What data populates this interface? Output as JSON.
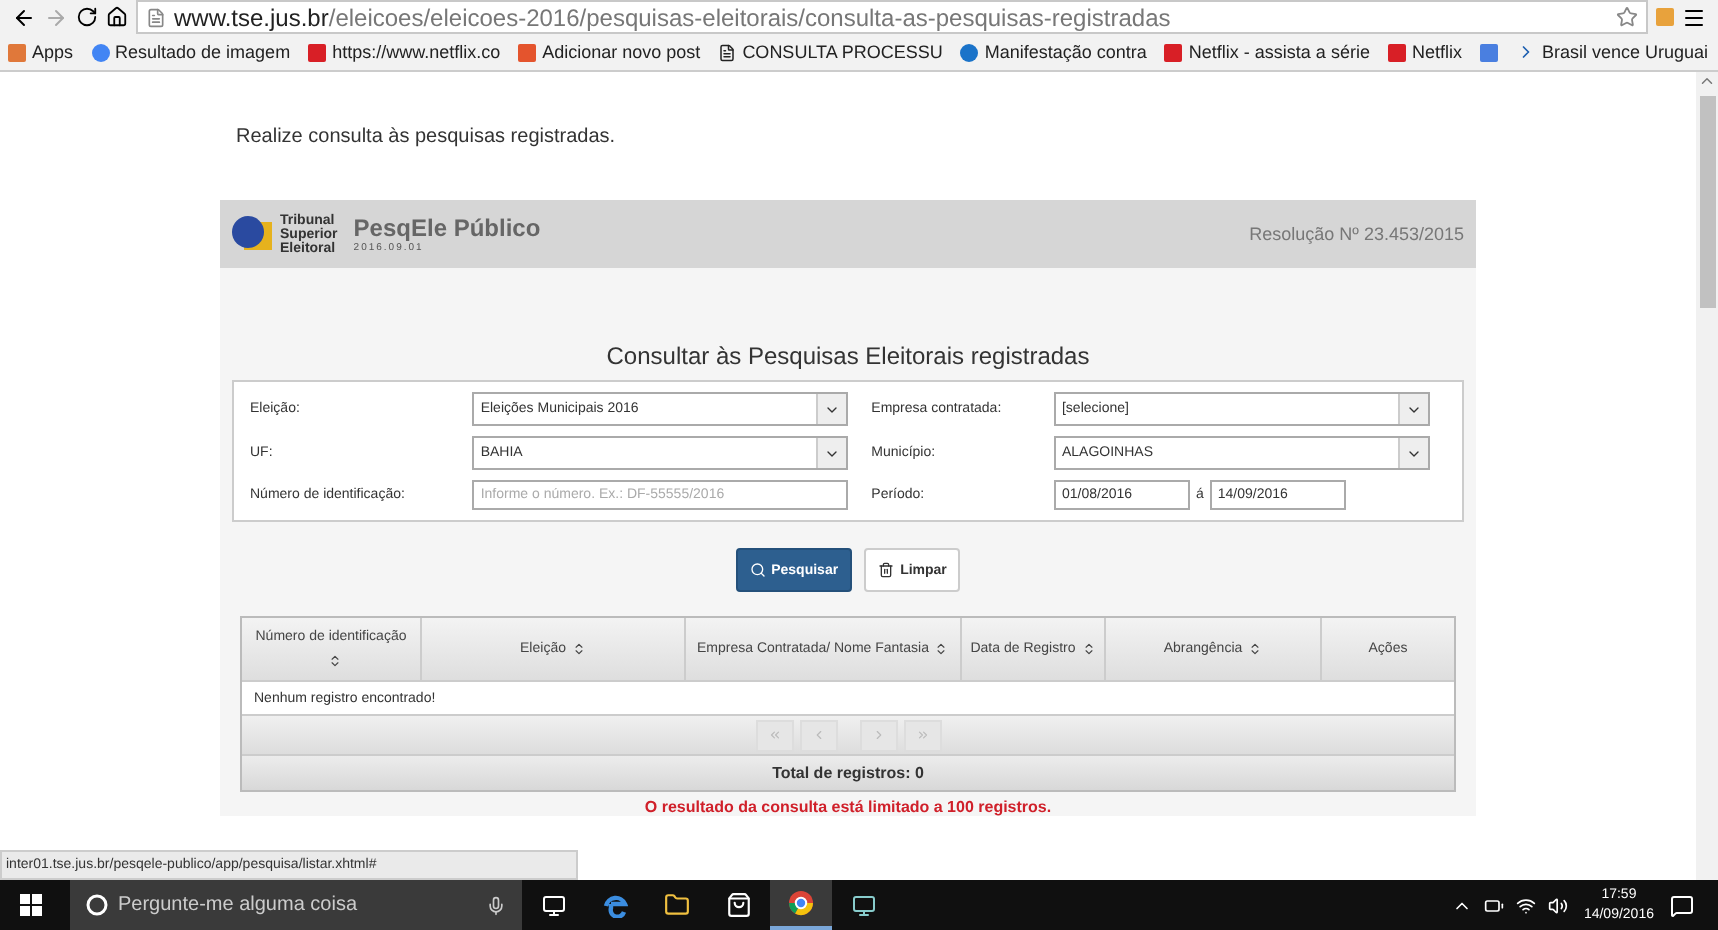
{
  "browser": {
    "url_host": "www.tse.jus.br",
    "url_path": "/eleicoes/eleicoes-2016/pesquisas-eleitorais/consulta-as-pesquisas-registradas",
    "bookmarks": [
      {
        "label": "Apps",
        "kind": "apps"
      },
      {
        "label": "Resultado de imagem",
        "kind": "google"
      },
      {
        "label": "https://www.netflix.co",
        "kind": "netflix"
      },
      {
        "label": "Adicionar novo post",
        "kind": "blog"
      },
      {
        "label": "CONSULTA PROCESSU",
        "kind": "page"
      },
      {
        "label": "Manifestação contra",
        "kind": "globe"
      },
      {
        "label": "Netflix - assista a série",
        "kind": "netflix"
      },
      {
        "label": "Netflix",
        "kind": "netflix"
      },
      {
        "kind": "doc"
      },
      {
        "label": "Brasil vence Uruguai",
        "kind": "arrow"
      }
    ]
  },
  "page": {
    "intro": "Realize consulta às pesquisas registradas.",
    "header": {
      "org_lines": [
        "Tribunal",
        "Superior",
        "Eleitoral"
      ],
      "title": "PesqEle Público",
      "version": "2016.09.01",
      "resolution": "Resolução Nº 23.453/2015"
    },
    "form_title": "Consultar às Pesquisas Eleitorais registradas",
    "fields": [
      {
        "label": "Eleição:",
        "kind": "select",
        "value": "Eleições Municipais 2016"
      },
      {
        "label": "Empresa contratada:",
        "kind": "select",
        "value": "[selecione]"
      },
      {
        "label": "UF:",
        "kind": "select",
        "value": "BAHIA"
      },
      {
        "label": "Município:",
        "kind": "select",
        "value": "ALAGOINHAS"
      },
      {
        "label": "Número de identificação:",
        "kind": "input",
        "placeholder": "Informe o número. Ex.: DF-55555/2016"
      },
      {
        "label": "Período:",
        "kind": "range",
        "from": "01/08/2016",
        "separator": "á",
        "to": "14/09/2016"
      }
    ],
    "buttons": [
      {
        "label": "Pesquisar",
        "kind": "primary"
      },
      {
        "label": "Limpar",
        "kind": "secondary"
      }
    ],
    "table": {
      "columns": [
        {
          "label": "Número de identificação",
          "sortable": true
        },
        {
          "label": "Eleição",
          "sortable": true
        },
        {
          "label": "Empresa Contratada/ Nome Fantasia",
          "sortable": true
        },
        {
          "label": "Data de Registro",
          "sortable": true
        },
        {
          "label": "Abrangência",
          "sortable": true
        },
        {
          "label": "Ações",
          "sortable": false
        }
      ],
      "empty_message": "Nenhum registro encontrado!",
      "total": "Total de registros: 0"
    },
    "limit_note": "O resultado da consulta está limitado a 100 registros."
  },
  "status_url": "inter01.tse.jus.br/pesqele-publico/app/pesquisa/listar.xhtml#",
  "taskbar": {
    "search_placeholder": "Pergunte-me alguma coisa",
    "time": "17:59",
    "date": "14/09/2016"
  }
}
